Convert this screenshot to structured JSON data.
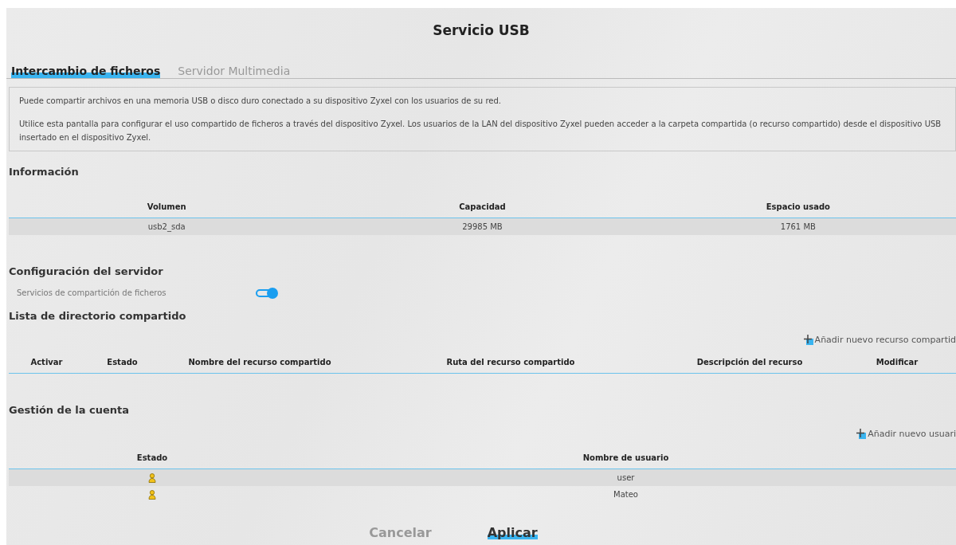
{
  "title": "Servicio USB",
  "tabs": [
    {
      "label": "Intercambio de ficheros",
      "selected": true
    },
    {
      "label": "Servidor Multimedia",
      "selected": false
    }
  ],
  "intro": [
    "Puede compartir archivos en una memoria USB o disco duro conectado a su dispositivo Zyxel con los usuarios de su red.",
    "Utilice esta pantalla para configurar el uso compartido de ficheros a través del dispositivo Zyxel. Los usuarios de la LAN del dispositivo Zyxel pueden acceder a la carpeta compartida (o recurso compartido) desde el dispositivo USB insertado en el dispositivo Zyxel."
  ],
  "information": {
    "heading": "Información",
    "columns": [
      "Volumen",
      "Capacidad",
      "Espacio usado"
    ],
    "rows": [
      [
        "usb2_sda",
        "29985 MB",
        "1761 MB"
      ]
    ]
  },
  "server_config": {
    "heading": "Configuración del servidor",
    "label": "Servicios de compartición de ficheros",
    "on": true
  },
  "shares": {
    "heading": "Lista de directorio compartido",
    "add_link": "Añadir nuevo recurso compartid",
    "columns": [
      "Activar",
      "Estado",
      "Nombre del recurso compartido",
      "Ruta del recurso compartido",
      "Descripción del recurso",
      "Modificar"
    ]
  },
  "accounts": {
    "heading": "Gestión de la cuenta",
    "add_link": "Añadir nuevo usuari",
    "columns": [
      "Estado",
      "Nombre de usuario"
    ],
    "rows": [
      {
        "name": "user"
      },
      {
        "name": "Mateo"
      }
    ]
  },
  "buttons": [
    {
      "label": "Cancelar",
      "kind": "secondary"
    },
    {
      "label": "Aplicar",
      "kind": "primary"
    }
  ]
}
